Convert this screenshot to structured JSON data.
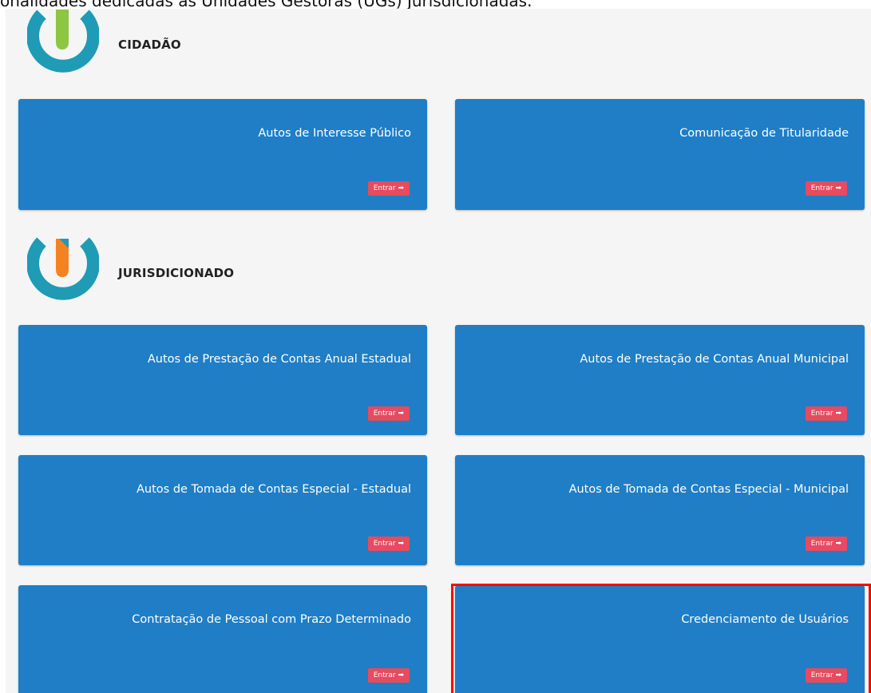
{
  "intro": {
    "text": "onalidades dedicadas às Unidades Gestoras (UGs) Jurisdicionadas."
  },
  "sections": [
    {
      "title": "CIDADÃO",
      "logo_icon": "cidadao-logo-icon",
      "accent_color": "#8dc63f",
      "cards": [
        {
          "title": "Autos de Interesse Público",
          "button": "Entrar ➡"
        },
        {
          "title": "Comunicação de Titularidade",
          "button": "Entrar ➡"
        }
      ]
    },
    {
      "title": "JURISDICIONADO",
      "logo_icon": "jurisdicionado-logo-icon",
      "accent_color": "#f58220",
      "cards": [
        {
          "title": "Autos de Prestação de Contas Anual Estadual",
          "button": "Entrar ➡"
        },
        {
          "title": "Autos de Prestação de Contas Anual Municipal",
          "button": "Entrar ➡"
        },
        {
          "title": "Autos de Tomada de Contas Especial - Estadual",
          "button": "Entrar ➡"
        },
        {
          "title": "Autos de Tomada de Contas Especial - Municipal",
          "button": "Entrar ➡"
        },
        {
          "title": "Contratação de Pessoal com Prazo Determinado",
          "button": "Entrar ➡"
        },
        {
          "title": "Credenciamento de Usuários",
          "button": "Entrar ➡"
        }
      ]
    }
  ],
  "colors": {
    "card_bg": "#1f7ec6",
    "button_bg": "#e84a5f",
    "logo_ring": "#1f9bb5",
    "highlight": "#ff0000"
  }
}
